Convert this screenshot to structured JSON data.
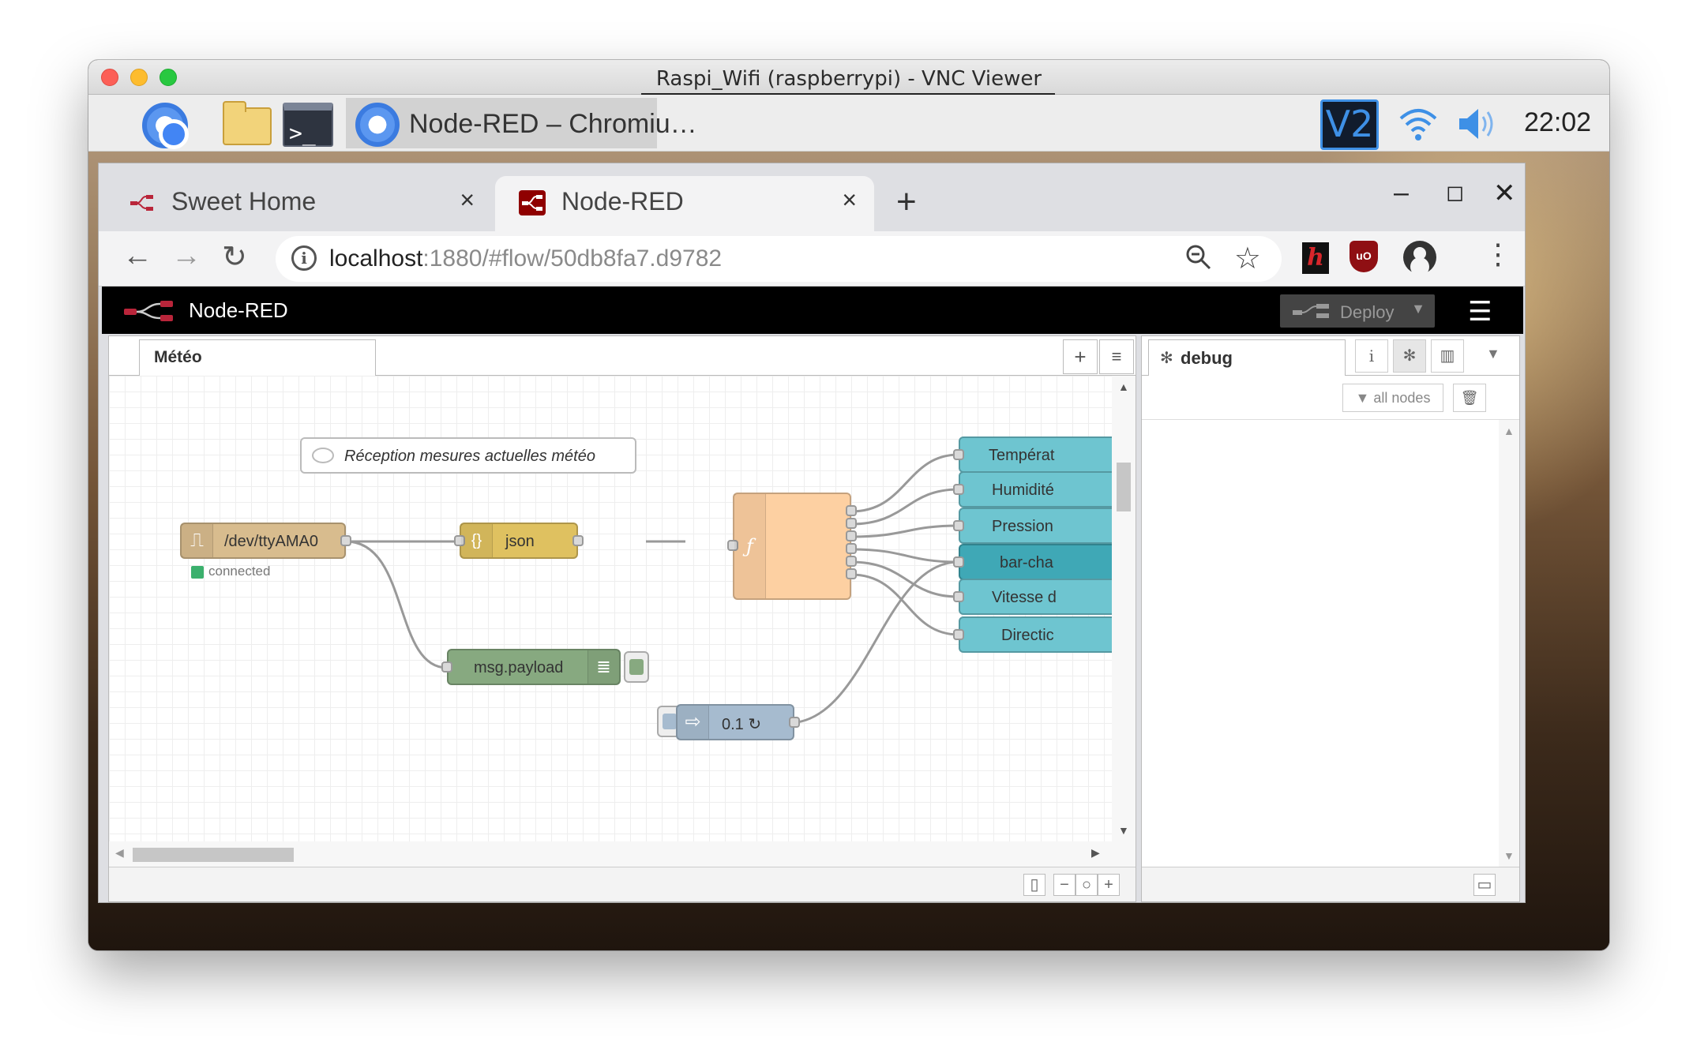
{
  "window": {
    "title": "Raspi_Wifi (raspberrypi) - VNC Viewer"
  },
  "taskbar": {
    "active_task": "Node-RED – Chromiu…",
    "clock": "22:02"
  },
  "browser": {
    "tabs": [
      {
        "title": "Sweet Home",
        "close": "×"
      },
      {
        "title": "Node-RED",
        "close": "×"
      }
    ],
    "new_tab": "+",
    "url_host": "localhost",
    "url_rest": ":1880/#flow/50db8fa7.d9782"
  },
  "nodered": {
    "header_title": "Node-RED",
    "deploy_label": "Deploy",
    "workspace_tab": "Météo",
    "comment": "Réception mesures actuelles météo",
    "serial_node": "/dev/ttyAMA0",
    "serial_status": "connected",
    "json_node": "json",
    "debug_node": "msg.payload",
    "inject_node": "0.1 ↻",
    "outputs": [
      "Températ",
      "Humidité",
      "Pression",
      "bar-cha",
      "Vitesse d",
      "Directic"
    ]
  },
  "sidebar": {
    "tab_label": "debug",
    "filter_label": "all nodes"
  },
  "colors": {
    "serial": "#d8bc8e",
    "json": "#dfc160",
    "function": "#fdd0a2",
    "debug": "#87a980",
    "inject": "#a6bbcf",
    "dashboard": "#6ec5d0",
    "dashboard_dark": "#3fa8b6"
  }
}
